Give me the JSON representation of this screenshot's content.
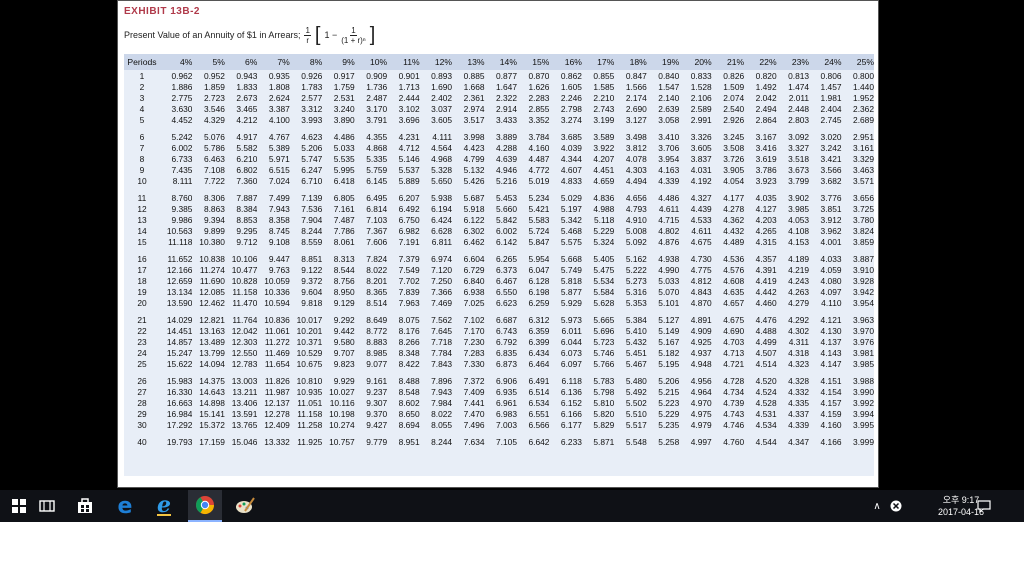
{
  "exhibit": {
    "title": "EXHIBIT 13B-2",
    "subtitle": "Present Value of an Annuity of $1 in Arrears;",
    "formula_num": "1",
    "formula_den": "r",
    "formula_one": "1 −",
    "formula_inner_num": "1",
    "formula_inner_den": "(1 + r)ⁿ"
  },
  "table": {
    "headers": [
      "Periods",
      "4%",
      "5%",
      "6%",
      "7%",
      "8%",
      "9%",
      "10%",
      "11%",
      "12%",
      "13%",
      "14%",
      "15%",
      "16%",
      "17%",
      "18%",
      "19%",
      "20%",
      "21%",
      "22%",
      "23%",
      "24%",
      "25%"
    ],
    "groups": [
      [
        [
          "1",
          "0.962",
          "0.952",
          "0.943",
          "0.935",
          "0.926",
          "0.917",
          "0.909",
          "0.901",
          "0.893",
          "0.885",
          "0.877",
          "0.870",
          "0.862",
          "0.855",
          "0.847",
          "0.840",
          "0.833",
          "0.826",
          "0.820",
          "0.813",
          "0.806",
          "0.800"
        ],
        [
          "2",
          "1.886",
          "1.859",
          "1.833",
          "1.808",
          "1.783",
          "1.759",
          "1.736",
          "1.713",
          "1.690",
          "1.668",
          "1.647",
          "1.626",
          "1.605",
          "1.585",
          "1.566",
          "1.547",
          "1.528",
          "1.509",
          "1.492",
          "1.474",
          "1.457",
          "1.440"
        ],
        [
          "3",
          "2.775",
          "2.723",
          "2.673",
          "2.624",
          "2.577",
          "2.531",
          "2.487",
          "2.444",
          "2.402",
          "2.361",
          "2.322",
          "2.283",
          "2.246",
          "2.210",
          "2.174",
          "2.140",
          "2.106",
          "2.074",
          "2.042",
          "2.011",
          "1.981",
          "1.952"
        ],
        [
          "4",
          "3.630",
          "3.546",
          "3.465",
          "3.387",
          "3.312",
          "3.240",
          "3.170",
          "3.102",
          "3.037",
          "2.974",
          "2.914",
          "2.855",
          "2.798",
          "2.743",
          "2.690",
          "2.639",
          "2.589",
          "2.540",
          "2.494",
          "2.448",
          "2.404",
          "2.362"
        ],
        [
          "5",
          "4.452",
          "4.329",
          "4.212",
          "4.100",
          "3.993",
          "3.890",
          "3.791",
          "3.696",
          "3.605",
          "3.517",
          "3.433",
          "3.352",
          "3.274",
          "3.199",
          "3.127",
          "3.058",
          "2.991",
          "2.926",
          "2.864",
          "2.803",
          "2.745",
          "2.689"
        ]
      ],
      [
        [
          "6",
          "5.242",
          "5.076",
          "4.917",
          "4.767",
          "4.623",
          "4.486",
          "4.355",
          "4.231",
          "4.111",
          "3.998",
          "3.889",
          "3.784",
          "3.685",
          "3.589",
          "3.498",
          "3.410",
          "3.326",
          "3.245",
          "3.167",
          "3.092",
          "3.020",
          "2.951"
        ],
        [
          "7",
          "6.002",
          "5.786",
          "5.582",
          "5.389",
          "5.206",
          "5.033",
          "4.868",
          "4.712",
          "4.564",
          "4.423",
          "4.288",
          "4.160",
          "4.039",
          "3.922",
          "3.812",
          "3.706",
          "3.605",
          "3.508",
          "3.416",
          "3.327",
          "3.242",
          "3.161"
        ],
        [
          "8",
          "6.733",
          "6.463",
          "6.210",
          "5.971",
          "5.747",
          "5.535",
          "5.335",
          "5.146",
          "4.968",
          "4.799",
          "4.639",
          "4.487",
          "4.344",
          "4.207",
          "4.078",
          "3.954",
          "3.837",
          "3.726",
          "3.619",
          "3.518",
          "3.421",
          "3.329"
        ],
        [
          "9",
          "7.435",
          "7.108",
          "6.802",
          "6.515",
          "6.247",
          "5.995",
          "5.759",
          "5.537",
          "5.328",
          "5.132",
          "4.946",
          "4.772",
          "4.607",
          "4.451",
          "4.303",
          "4.163",
          "4.031",
          "3.905",
          "3.786",
          "3.673",
          "3.566",
          "3.463"
        ],
        [
          "10",
          "8.111",
          "7.722",
          "7.360",
          "7.024",
          "6.710",
          "6.418",
          "6.145",
          "5.889",
          "5.650",
          "5.426",
          "5.216",
          "5.019",
          "4.833",
          "4.659",
          "4.494",
          "4.339",
          "4.192",
          "4.054",
          "3.923",
          "3.799",
          "3.682",
          "3.571"
        ]
      ],
      [
        [
          "11",
          "8.760",
          "8.306",
          "7.887",
          "7.499",
          "7.139",
          "6.805",
          "6.495",
          "6.207",
          "5.938",
          "5.687",
          "5.453",
          "5.234",
          "5.029",
          "4.836",
          "4.656",
          "4.486",
          "4.327",
          "4.177",
          "4.035",
          "3.902",
          "3.776",
          "3.656"
        ],
        [
          "12",
          "9.385",
          "8.863",
          "8.384",
          "7.943",
          "7.536",
          "7.161",
          "6.814",
          "6.492",
          "6.194",
          "5.918",
          "5.660",
          "5.421",
          "5.197",
          "4.988",
          "4.793",
          "4.611",
          "4.439",
          "4.278",
          "4.127",
          "3.985",
          "3.851",
          "3.725"
        ],
        [
          "13",
          "9.986",
          "9.394",
          "8.853",
          "8.358",
          "7.904",
          "7.487",
          "7.103",
          "6.750",
          "6.424",
          "6.122",
          "5.842",
          "5.583",
          "5.342",
          "5.118",
          "4.910",
          "4.715",
          "4.533",
          "4.362",
          "4.203",
          "4.053",
          "3.912",
          "3.780"
        ],
        [
          "14",
          "10.563",
          "9.899",
          "9.295",
          "8.745",
          "8.244",
          "7.786",
          "7.367",
          "6.982",
          "6.628",
          "6.302",
          "6.002",
          "5.724",
          "5.468",
          "5.229",
          "5.008",
          "4.802",
          "4.611",
          "4.432",
          "4.265",
          "4.108",
          "3.962",
          "3.824"
        ],
        [
          "15",
          "11.118",
          "10.380",
          "9.712",
          "9.108",
          "8.559",
          "8.061",
          "7.606",
          "7.191",
          "6.811",
          "6.462",
          "6.142",
          "5.847",
          "5.575",
          "5.324",
          "5.092",
          "4.876",
          "4.675",
          "4.489",
          "4.315",
          "4.153",
          "4.001",
          "3.859"
        ]
      ],
      [
        [
          "16",
          "11.652",
          "10.838",
          "10.106",
          "9.447",
          "8.851",
          "8.313",
          "7.824",
          "7.379",
          "6.974",
          "6.604",
          "6.265",
          "5.954",
          "5.668",
          "5.405",
          "5.162",
          "4.938",
          "4.730",
          "4.536",
          "4.357",
          "4.189",
          "4.033",
          "3.887"
        ],
        [
          "17",
          "12.166",
          "11.274",
          "10.477",
          "9.763",
          "9.122",
          "8.544",
          "8.022",
          "7.549",
          "7.120",
          "6.729",
          "6.373",
          "6.047",
          "5.749",
          "5.475",
          "5.222",
          "4.990",
          "4.775",
          "4.576",
          "4.391",
          "4.219",
          "4.059",
          "3.910"
        ],
        [
          "18",
          "12.659",
          "11.690",
          "10.828",
          "10.059",
          "9.372",
          "8.756",
          "8.201",
          "7.702",
          "7.250",
          "6.840",
          "6.467",
          "6.128",
          "5.818",
          "5.534",
          "5.273",
          "5.033",
          "4.812",
          "4.608",
          "4.419",
          "4.243",
          "4.080",
          "3.928"
        ],
        [
          "19",
          "13.134",
          "12.085",
          "11.158",
          "10.336",
          "9.604",
          "8.950",
          "8.365",
          "7.839",
          "7.366",
          "6.938",
          "6.550",
          "6.198",
          "5.877",
          "5.584",
          "5.316",
          "5.070",
          "4.843",
          "4.635",
          "4.442",
          "4.263",
          "4.097",
          "3.942"
        ],
        [
          "20",
          "13.590",
          "12.462",
          "11.470",
          "10.594",
          "9.818",
          "9.129",
          "8.514",
          "7.963",
          "7.469",
          "7.025",
          "6.623",
          "6.259",
          "5.929",
          "5.628",
          "5.353",
          "5.101",
          "4.870",
          "4.657",
          "4.460",
          "4.279",
          "4.110",
          "3.954"
        ]
      ],
      [
        [
          "21",
          "14.029",
          "12.821",
          "11.764",
          "10.836",
          "10.017",
          "9.292",
          "8.649",
          "8.075",
          "7.562",
          "7.102",
          "6.687",
          "6.312",
          "5.973",
          "5.665",
          "5.384",
          "5.127",
          "4.891",
          "4.675",
          "4.476",
          "4.292",
          "4.121",
          "3.963"
        ],
        [
          "22",
          "14.451",
          "13.163",
          "12.042",
          "11.061",
          "10.201",
          "9.442",
          "8.772",
          "8.176",
          "7.645",
          "7.170",
          "6.743",
          "6.359",
          "6.011",
          "5.696",
          "5.410",
          "5.149",
          "4.909",
          "4.690",
          "4.488",
          "4.302",
          "4.130",
          "3.970"
        ],
        [
          "23",
          "14.857",
          "13.489",
          "12.303",
          "11.272",
          "10.371",
          "9.580",
          "8.883",
          "8.266",
          "7.718",
          "7.230",
          "6.792",
          "6.399",
          "6.044",
          "5.723",
          "5.432",
          "5.167",
          "4.925",
          "4.703",
          "4.499",
          "4.311",
          "4.137",
          "3.976"
        ],
        [
          "24",
          "15.247",
          "13.799",
          "12.550",
          "11.469",
          "10.529",
          "9.707",
          "8.985",
          "8.348",
          "7.784",
          "7.283",
          "6.835",
          "6.434",
          "6.073",
          "5.746",
          "5.451",
          "5.182",
          "4.937",
          "4.713",
          "4.507",
          "4.318",
          "4.143",
          "3.981"
        ],
        [
          "25",
          "15.622",
          "14.094",
          "12.783",
          "11.654",
          "10.675",
          "9.823",
          "9.077",
          "8.422",
          "7.843",
          "7.330",
          "6.873",
          "6.464",
          "6.097",
          "5.766",
          "5.467",
          "5.195",
          "4.948",
          "4.721",
          "4.514",
          "4.323",
          "4.147",
          "3.985"
        ]
      ],
      [
        [
          "26",
          "15.983",
          "14.375",
          "13.003",
          "11.826",
          "10.810",
          "9.929",
          "9.161",
          "8.488",
          "7.896",
          "7.372",
          "6.906",
          "6.491",
          "6.118",
          "5.783",
          "5.480",
          "5.206",
          "4.956",
          "4.728",
          "4.520",
          "4.328",
          "4.151",
          "3.988"
        ],
        [
          "27",
          "16.330",
          "14.643",
          "13.211",
          "11.987",
          "10.935",
          "10.027",
          "9.237",
          "8.548",
          "7.943",
          "7.409",
          "6.935",
          "6.514",
          "6.136",
          "5.798",
          "5.492",
          "5.215",
          "4.964",
          "4.734",
          "4.524",
          "4.332",
          "4.154",
          "3.990"
        ],
        [
          "28",
          "16.663",
          "14.898",
          "13.406",
          "12.137",
          "11.051",
          "10.116",
          "9.307",
          "8.602",
          "7.984",
          "7.441",
          "6.961",
          "6.534",
          "6.152",
          "5.810",
          "5.502",
          "5.223",
          "4.970",
          "4.739",
          "4.528",
          "4.335",
          "4.157",
          "3.992"
        ],
        [
          "29",
          "16.984",
          "15.141",
          "13.591",
          "12.278",
          "11.158",
          "10.198",
          "9.370",
          "8.650",
          "8.022",
          "7.470",
          "6.983",
          "6.551",
          "6.166",
          "5.820",
          "5.510",
          "5.229",
          "4.975",
          "4.743",
          "4.531",
          "4.337",
          "4.159",
          "3.994"
        ],
        [
          "30",
          "17.292",
          "15.372",
          "13.765",
          "12.409",
          "11.258",
          "10.274",
          "9.427",
          "8.694",
          "8.055",
          "7.496",
          "7.003",
          "6.566",
          "6.177",
          "5.829",
          "5.517",
          "5.235",
          "4.979",
          "4.746",
          "4.534",
          "4.339",
          "4.160",
          "3.995"
        ]
      ],
      [
        [
          "40",
          "19.793",
          "17.159",
          "15.046",
          "13.332",
          "11.925",
          "10.757",
          "9.779",
          "8.951",
          "8.244",
          "7.634",
          "7.105",
          "6.642",
          "6.233",
          "5.871",
          "5.548",
          "5.258",
          "4.997",
          "4.760",
          "4.544",
          "4.347",
          "4.166",
          "3.999"
        ]
      ]
    ]
  },
  "taskbar": {
    "items": [
      "start-icon",
      "task-view-icon",
      "store-icon",
      "edge-icon",
      "ie-icon",
      "chrome-icon",
      "paint-icon"
    ],
    "clock_time": "오후 9:17",
    "clock_date": "2017-04-16",
    "colors": {
      "bar": "#0f1116",
      "edge": "#1e7fd6",
      "chrome_red": "#db4437",
      "chrome_yellow": "#f4b400",
      "chrome_green": "#0f9d58",
      "chrome_blue": "#4285f4"
    }
  }
}
